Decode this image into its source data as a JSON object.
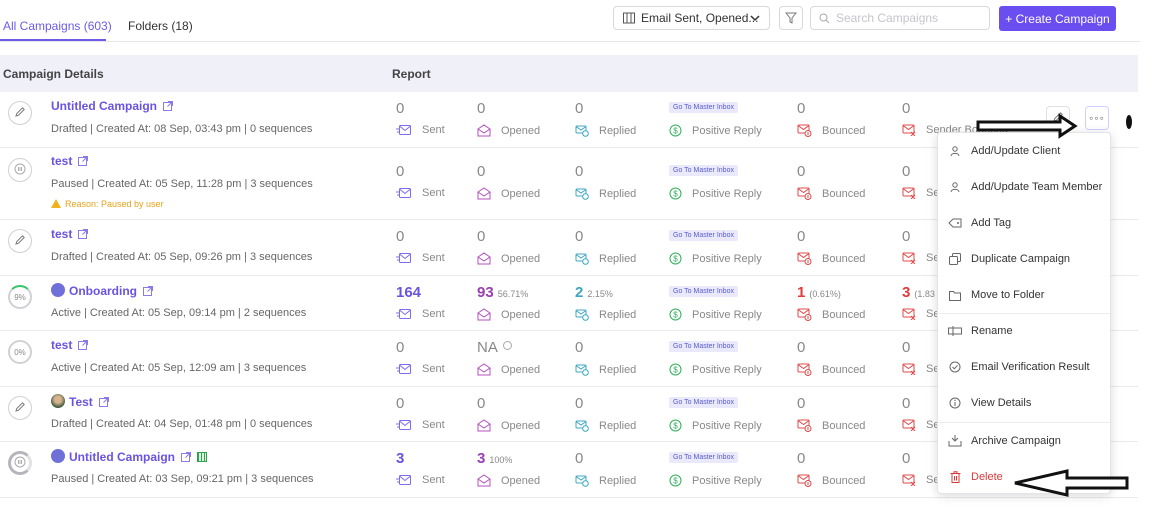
{
  "tabs": {
    "all_label": "All Campaigns (603)",
    "folders_label": "Folders (18)"
  },
  "toolbar": {
    "columns_label": "Email Sent, Opened...",
    "search_placeholder": "Search Campaigns",
    "create_label": "+ Create Campaign"
  },
  "table": {
    "headers": {
      "details": "Campaign Details",
      "report": "Report"
    },
    "stat_labels": {
      "sent": "Sent",
      "opened": "Opened",
      "replied": "Replied",
      "positive": "Positive Reply",
      "bounced": "Bounced",
      "sender_bounced": "Sender Bounced",
      "sender_bounced_short": "Sen"
    },
    "master_inbox_label": "Go To Master Inbox",
    "rows": [
      {
        "status_icon": "pencil-icon",
        "name": "Untitled Campaign",
        "meta": "Drafted | Created At: 08 Sep, 03:43 pm | 0 sequences",
        "sent": "0",
        "opened": "0",
        "replied": "0",
        "bounced": "0",
        "sender_bounced": "0"
      },
      {
        "status_icon": "pause-icon",
        "name": "test",
        "meta": "Paused | Created At: 05 Sep, 11:28 pm | 3 sequences",
        "warning": "Reason: Paused by user",
        "sent": "0",
        "opened": "0",
        "replied": "0",
        "bounced": "0",
        "sender_bounced": "0"
      },
      {
        "status_icon": "pencil-icon",
        "name": "test",
        "meta": "Drafted | Created At: 05 Sep, 09:26 pm | 3 sequences",
        "sent": "0",
        "opened": "0",
        "replied": "0",
        "bounced": "0",
        "sender_bounced": "0"
      },
      {
        "status_text": "9%",
        "name": "Onboarding",
        "meta": "Active | Created At: 05 Sep, 09:14 pm | 2 sequences",
        "sent": "164",
        "opened": "93",
        "opened_pct": "56.71%",
        "replied": "2",
        "replied_pct": "2.15%",
        "bounced": "1",
        "bounced_pct": "(0.61%)",
        "sender_bounced": "3",
        "sender_bounced_pct": "(1.83"
      },
      {
        "status_text": "0%",
        "name": "test",
        "meta": "Active | Created At: 05 Sep, 12:09 am | 3 sequences",
        "sent": "0",
        "opened": "NA",
        "replied": "0",
        "bounced": "0",
        "sender_bounced": "0"
      },
      {
        "status_icon": "pencil-icon",
        "name": "Test",
        "meta": "Drafted | Created At: 04 Sep, 01:48 pm | 0 sequences",
        "sent": "0",
        "opened": "0",
        "replied": "0",
        "bounced": "0",
        "sender_bounced": "0"
      },
      {
        "status_icon": "pause-icon",
        "name": "Untitled Campaign",
        "meta": "Paused | Created At: 03 Sep, 09:21 pm | 3 sequences",
        "sent": "3",
        "opened": "3",
        "opened_pct": "100%",
        "replied": "0",
        "bounced": "0",
        "sender_bounced": "0"
      }
    ]
  },
  "menu": {
    "items": [
      "Add/Update Client",
      "Add/Update Team Member",
      "Add Tag",
      "Duplicate Campaign",
      "Move to Folder",
      "Rename",
      "Email Verification Result",
      "View Details",
      "Archive Campaign",
      "Delete"
    ]
  },
  "colors": {
    "accent": "#6b4ef0",
    "link": "#6a53e0",
    "danger": "#d83a3a",
    "warning": "#e7a21b",
    "positive": "#2fae58"
  }
}
